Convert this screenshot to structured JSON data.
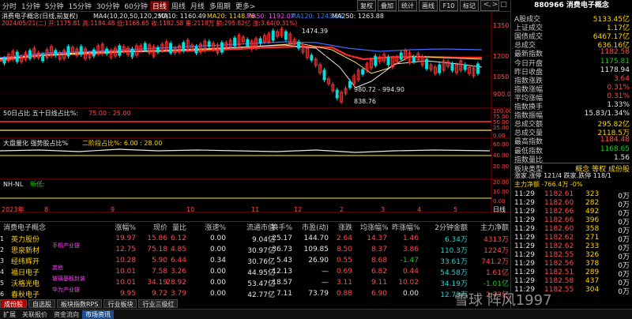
{
  "toolbar": {
    "items": [
      "分时",
      "1分钟",
      "5分钟",
      "15分钟",
      "30分钟",
      "60分钟",
      "日线",
      "周线",
      "月线",
      "多周期",
      "更多>"
    ],
    "active": 6,
    "right_buttons": [
      "复权",
      "叠加",
      "统计",
      "画线",
      "F10",
      "标记",
      "-"
    ],
    "win": [
      "<",
      ">",
      "□",
      "×"
    ]
  },
  "chart": {
    "header1": {
      "name": "消费电子概念(日线,前复权)",
      "ma4": "MA4(10,20,50,120,250)",
      "ma10": "MA10: 1160.49",
      "ma20": "MA20: 1148.76",
      "ma50": "MA50: 1192.07",
      "ma120": "MA120: 1243.88",
      "ma250": "MA250: 1263.88"
    },
    "header2": "2024/05/21(二) 开:1175.81 高:1184.48 低:1168.65 收:1182.58 量:2118万 额:295.82亿 涨:3.64(0.31%)",
    "price_ticks": [
      "1350",
      "1200",
      "1050",
      "900.00"
    ],
    "annot_high": "1474.39",
    "annot_mid": "980.72 - 994.90",
    "annot_low": "838.76",
    "sub1_label": "50日占比 五十日线占比%:",
    "sub1_vals": "75.00 : 25.00",
    "sub1_ticks": [
      "100.00",
      "75.00",
      "50.00",
      "25.00",
      "0.00"
    ],
    "sub2_label": "大盘量化 强势股占比%",
    "sub2_vals": "二阶段占比%: 6.00 : 28.00",
    "sub2_ticks": [
      "60.00",
      "40.00",
      "20.00"
    ],
    "sub3_label": "NH-NL",
    "sub3_vals": "新低:",
    "sub3_ticks": [
      "20.00",
      "10.00",
      "0.00"
    ],
    "date_axis": [
      "2023年",
      "8",
      "9",
      "10",
      "11",
      "12",
      "2",
      "3",
      "4",
      "5"
    ],
    "date_right": "日线"
  },
  "table": {
    "headers": [
      "消费电子概念",
      "涨幅%",
      "现价",
      "量比",
      "涨速%",
      "流通市值",
      "换手%",
      "市盈(动)",
      "涨跌",
      "均涨幅%",
      "昨涨幅%",
      "2分钟金额",
      "主力净额"
    ],
    "rows": [
      {
        "name": "英力股份",
        "tag": "",
        "v": [
          "19.97",
          "15.86",
          "6.12",
          "0.00",
          "9.04亿",
          "25.17",
          "144.70",
          "2.64",
          "14.37",
          "1.46",
          "6.34万",
          "4313万"
        ]
      },
      {
        "name": "思泉新材",
        "tag": "手机产业链",
        "v": [
          "12.75",
          "75.18",
          "4.85",
          "0.00",
          "30.97亿",
          "36.73",
          "109.85",
          "8.50",
          "8.37",
          "3.86",
          "110.3万",
          "1224万"
        ]
      },
      {
        "name": "经纬辉开",
        "tag": "",
        "v": [
          "10.28",
          "5.90",
          "6.44",
          "0.34",
          "30.76亿",
          "5.43",
          "26.90",
          "0.55",
          "8.68",
          "-1.47",
          "33.61万",
          "741.2万"
        ]
      },
      {
        "name": "福日电子",
        "tag": "其他",
        "v": [
          "10.01",
          "7.58",
          "3.26",
          "0.00",
          "44.95亿",
          "12.13",
          "—",
          "0.69",
          "6.82",
          "0.44",
          "54.58万",
          "1.61亿"
        ]
      },
      {
        "name": "沃格光电",
        "tag": "玻璃基板封装",
        "v": [
          "10.01",
          "34.19",
          "28.92",
          "0.00",
          "53.47亿",
          "18.57",
          "—",
          "3.11",
          "9.11",
          "10.02",
          "34.19万",
          "-1.01亿"
        ]
      },
      {
        "name": "春秋电子",
        "tag": "华为产业链",
        "v": [
          "9.95",
          "9.72",
          "3.79",
          "0.00",
          "42.77亿",
          "7.11",
          "73.79",
          "0.88",
          "6.90",
          "0.00",
          "12.73万",
          "2.73亿"
        ]
      }
    ]
  },
  "bottom_tabs": [
    "成份股",
    "自选股",
    "板块指数RPS",
    "行业板块",
    "行业三级红"
  ],
  "status": [
    "扩展",
    "关联报价",
    "资金流向",
    "市场资讯"
  ],
  "watermark": "雪球 阵风1997",
  "rp": {
    "title": "880966 消费电子概念",
    "rows": [
      {
        "k": "A股成交",
        "v": "5133.45亿",
        "c": "y"
      },
      {
        "k": "上证成交",
        "v": "1.17亿",
        "c": "y"
      },
      {
        "k": "国债成交",
        "v": "6467.17亿",
        "c": "y"
      },
      {
        "k": "总成交",
        "v": "636.16亿",
        "c": "y"
      },
      {
        "k": "最新指数",
        "v": "1182.58",
        "c": "r"
      },
      {
        "k": "今日开盘",
        "v": "1175.81",
        "c": "g"
      },
      {
        "k": "昨日收盘",
        "v": "1178.94",
        "c": "w"
      },
      {
        "k": "指数涨跌",
        "v": "3.64",
        "c": "r"
      },
      {
        "k": "指数涨幅",
        "v": "0.31%",
        "c": "r"
      },
      {
        "k": "平均涨幅",
        "v": "0.31%",
        "c": "r"
      },
      {
        "k": "指数换手",
        "v": "1.33%",
        "c": "w"
      },
      {
        "k": "指数振幅",
        "v": "15.83/1.34%",
        "c": "w"
      },
      {
        "k": "总成交额",
        "v": "295.82亿",
        "c": "y"
      },
      {
        "k": "总成交量",
        "v": "2118.5万",
        "c": "y"
      },
      {
        "k": "最高指数",
        "v": "1184.48",
        "c": "r"
      },
      {
        "k": "最低指数",
        "v": "1168.65",
        "c": "g"
      },
      {
        "k": "指数量比",
        "v": "1.56",
        "c": "w"
      }
    ],
    "sect": "板块类型",
    "sect_v": "概念 等权 成份股",
    "stat1": "涨家.涨停 121/4 跌家.跌停 118/1",
    "stat2": "主力净额 -766.4万 -0%",
    "ticks": [
      [
        "11:29",
        "1182.61",
        "323",
        "0万"
      ],
      [
        "11:29",
        "1182.60",
        "282",
        "0万"
      ],
      [
        "11:29",
        "1182.66",
        "492",
        "0万"
      ],
      [
        "11:29",
        "1182.66",
        "396",
        "0万"
      ],
      [
        "11:29",
        "1182.60",
        "358",
        "0万"
      ],
      [
        "11:29",
        "1182.62",
        "271",
        "0万"
      ],
      [
        "11:29",
        "1182.62",
        "233",
        "0万"
      ],
      [
        "11:29",
        "1182.55",
        "326",
        "0万"
      ],
      [
        "11:29",
        "1182.56",
        "378",
        "0万"
      ],
      [
        "11:29",
        "1182.51",
        "289",
        "0万"
      ],
      [
        "11:29",
        "1182.58",
        "437",
        "0万"
      ],
      [
        "11:29",
        "1182.55",
        "304",
        "0万"
      ]
    ]
  }
}
